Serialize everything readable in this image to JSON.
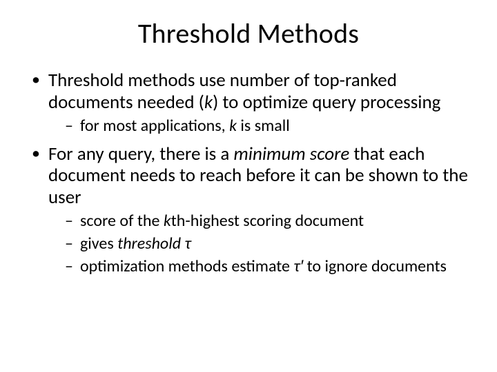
{
  "title": "Threshold Methods",
  "bullets": {
    "b1a": "Threshold methods use number of top-ranked documents needed (",
    "b1k": "k",
    "b1b": ") to optimize query processing",
    "b1s1a": "for most applications, ",
    "b1s1k": "k",
    "b1s1b": " is small",
    "b2a": "For any query, there is a ",
    "b2i": "minimum score",
    "b2b": " that each document needs to reach before it can be shown to the user",
    "b2s1a": "score of the ",
    "b2s1k": "k",
    "b2s1b": "th-highest scoring document",
    "b2s2a": "gives ",
    "b2s2i": "threshold τ",
    "b2s3a": "optimization methods estimate ",
    "b2s3i": "τ′",
    "b2s3b": " to ignore documents"
  }
}
